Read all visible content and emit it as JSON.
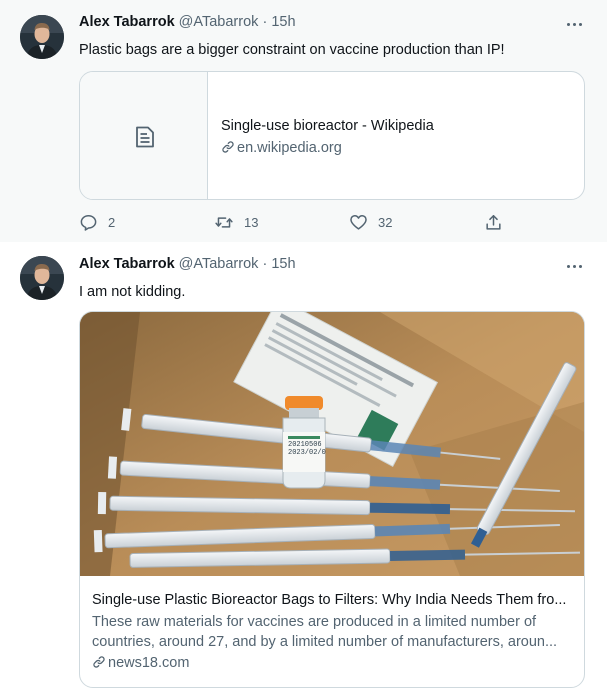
{
  "tweets": [
    {
      "author": {
        "name": "Alex Tabarrok",
        "handle": "@ATabarrok",
        "time": "15h",
        "separator": "·"
      },
      "text": "Plastic bags are a bigger constraint on vaccine production than IP!",
      "card": {
        "title": "Single-use bioreactor - Wikipedia",
        "domain": "en.wikipedia.org",
        "thumbnail_icon": "document-icon"
      },
      "actions": {
        "replies": "2",
        "retweets": "13",
        "likes": "32"
      }
    },
    {
      "author": {
        "name": "Alex Tabarrok",
        "handle": "@ATabarrok",
        "time": "15h",
        "separator": "·"
      },
      "text": "I am not kidding.",
      "card": {
        "title": "Single-use Plastic Bioreactor Bags to Filters: Why India Needs Them fro...",
        "description": [
          "These raw materials for vaccines are produced in a limited number of",
          "countries, around 27, and by a limited number of manufacturers, aroun..."
        ],
        "domain": "news18.com",
        "vial_label": [
          "20210506",
          "2023/02/0"
        ]
      }
    }
  ],
  "colors": {
    "secondary_text": "#536471",
    "border": "#cfd9de",
    "hover_bg": "#f7f9f9"
  }
}
